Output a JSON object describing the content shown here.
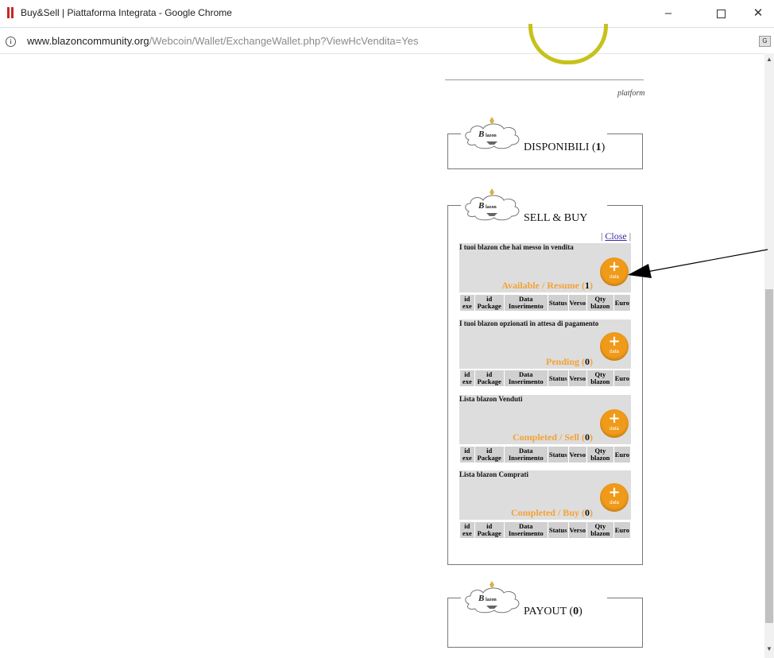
{
  "window": {
    "title": "Buy&Sell | Piattaforma Integrata - Google Chrome",
    "controls": {
      "minimize": "–",
      "close": "✕"
    }
  },
  "address": {
    "host": "www.blazoncommunity.org",
    "path": "/Webcoin/Wallet/ExchangeWallet.php?ViewHcVendita=Yes"
  },
  "platform_text": "platform",
  "panels": {
    "disponibili": {
      "title": "DISPONIBILI",
      "count": "1"
    },
    "sell_buy": {
      "title": "SELL & BUY",
      "close_label": "Close"
    },
    "payout": {
      "title": "PAYOUT",
      "count": "0"
    }
  },
  "columns": [
    "id exe",
    "id Package",
    "Data Inserimento",
    "Status",
    "Verso",
    "Qty blazon",
    "Euro"
  ],
  "sections": [
    {
      "caption": "I tuoi blazon che hai messo in vendita",
      "status": "Available / Resume",
      "count": "1"
    },
    {
      "caption": "I tuoi blazon opzionati in attesa di pagamento",
      "status": "Pending",
      "count": "0"
    },
    {
      "caption": "Lista blazon Venduti",
      "status": "Completed / Sell",
      "count": "0"
    },
    {
      "caption": "Lista blazon Comprati",
      "status": "Completed / Buy",
      "count": "0"
    }
  ],
  "button_label": "data",
  "colors": {
    "accent": "#f09a1a",
    "status_text": "#f4a236",
    "logo_ring": "#c7c21b"
  }
}
